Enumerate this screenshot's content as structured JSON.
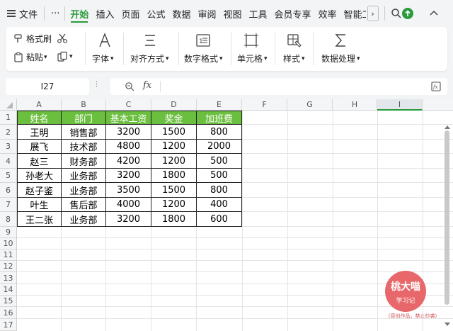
{
  "menubar": {
    "file": "文件",
    "more": "···",
    "tabs": [
      {
        "label": "开始",
        "active": true
      },
      {
        "label": "插入"
      },
      {
        "label": "页面"
      },
      {
        "label": "公式"
      },
      {
        "label": "数据"
      },
      {
        "label": "审阅"
      },
      {
        "label": "视图"
      },
      {
        "label": "工具"
      },
      {
        "label": "会员专享"
      },
      {
        "label": "效率"
      },
      {
        "label": "智能工"
      }
    ],
    "scroll_right": "›"
  },
  "ribbon": {
    "format_painter": "格式刷",
    "paste": "粘贴",
    "font": "字体",
    "align": "对齐方式",
    "number_format": "数字格式",
    "cell": "单元格",
    "style": "样式",
    "data_process": "数据处理",
    "dropdown_glyph": "▾"
  },
  "formula_bar": {
    "name_box": "I27",
    "fx": "fx",
    "zoom_glyph": "⊕",
    "content": ""
  },
  "sheet": {
    "columns": [
      "A",
      "B",
      "C",
      "D",
      "E",
      "F",
      "G",
      "H",
      "I"
    ],
    "selected_column": "I",
    "rows": [
      "1",
      "2",
      "3",
      "4",
      "5",
      "6",
      "7",
      "8",
      "9",
      "10",
      "11",
      "12",
      "13",
      "14",
      "15",
      "16",
      "17"
    ],
    "table": {
      "header": [
        "姓名",
        "部门",
        "基本工资",
        "奖金",
        "加班费"
      ],
      "data": [
        [
          "王明",
          "销售部",
          "3200",
          "1500",
          "800"
        ],
        [
          "展飞",
          "技术部",
          "4800",
          "1200",
          "2000"
        ],
        [
          "赵三",
          "财务部",
          "4200",
          "1200",
          "500"
        ],
        [
          "孙老大",
          "业务部",
          "3200",
          "1800",
          "500"
        ],
        [
          "赵子鉴",
          "业务部",
          "3500",
          "1500",
          "800"
        ],
        [
          "叶生",
          "售后部",
          "4000",
          "1200",
          "400"
        ],
        [
          "王二张",
          "业务部",
          "3200",
          "1800",
          "600"
        ]
      ]
    },
    "header_color": "#6bbf3f"
  },
  "watermark": {
    "name": "桃大喵",
    "sub": "学习记",
    "note": "(原创作品，禁止抄袭)"
  },
  "colors": {
    "accent": "#2b9a3c"
  }
}
